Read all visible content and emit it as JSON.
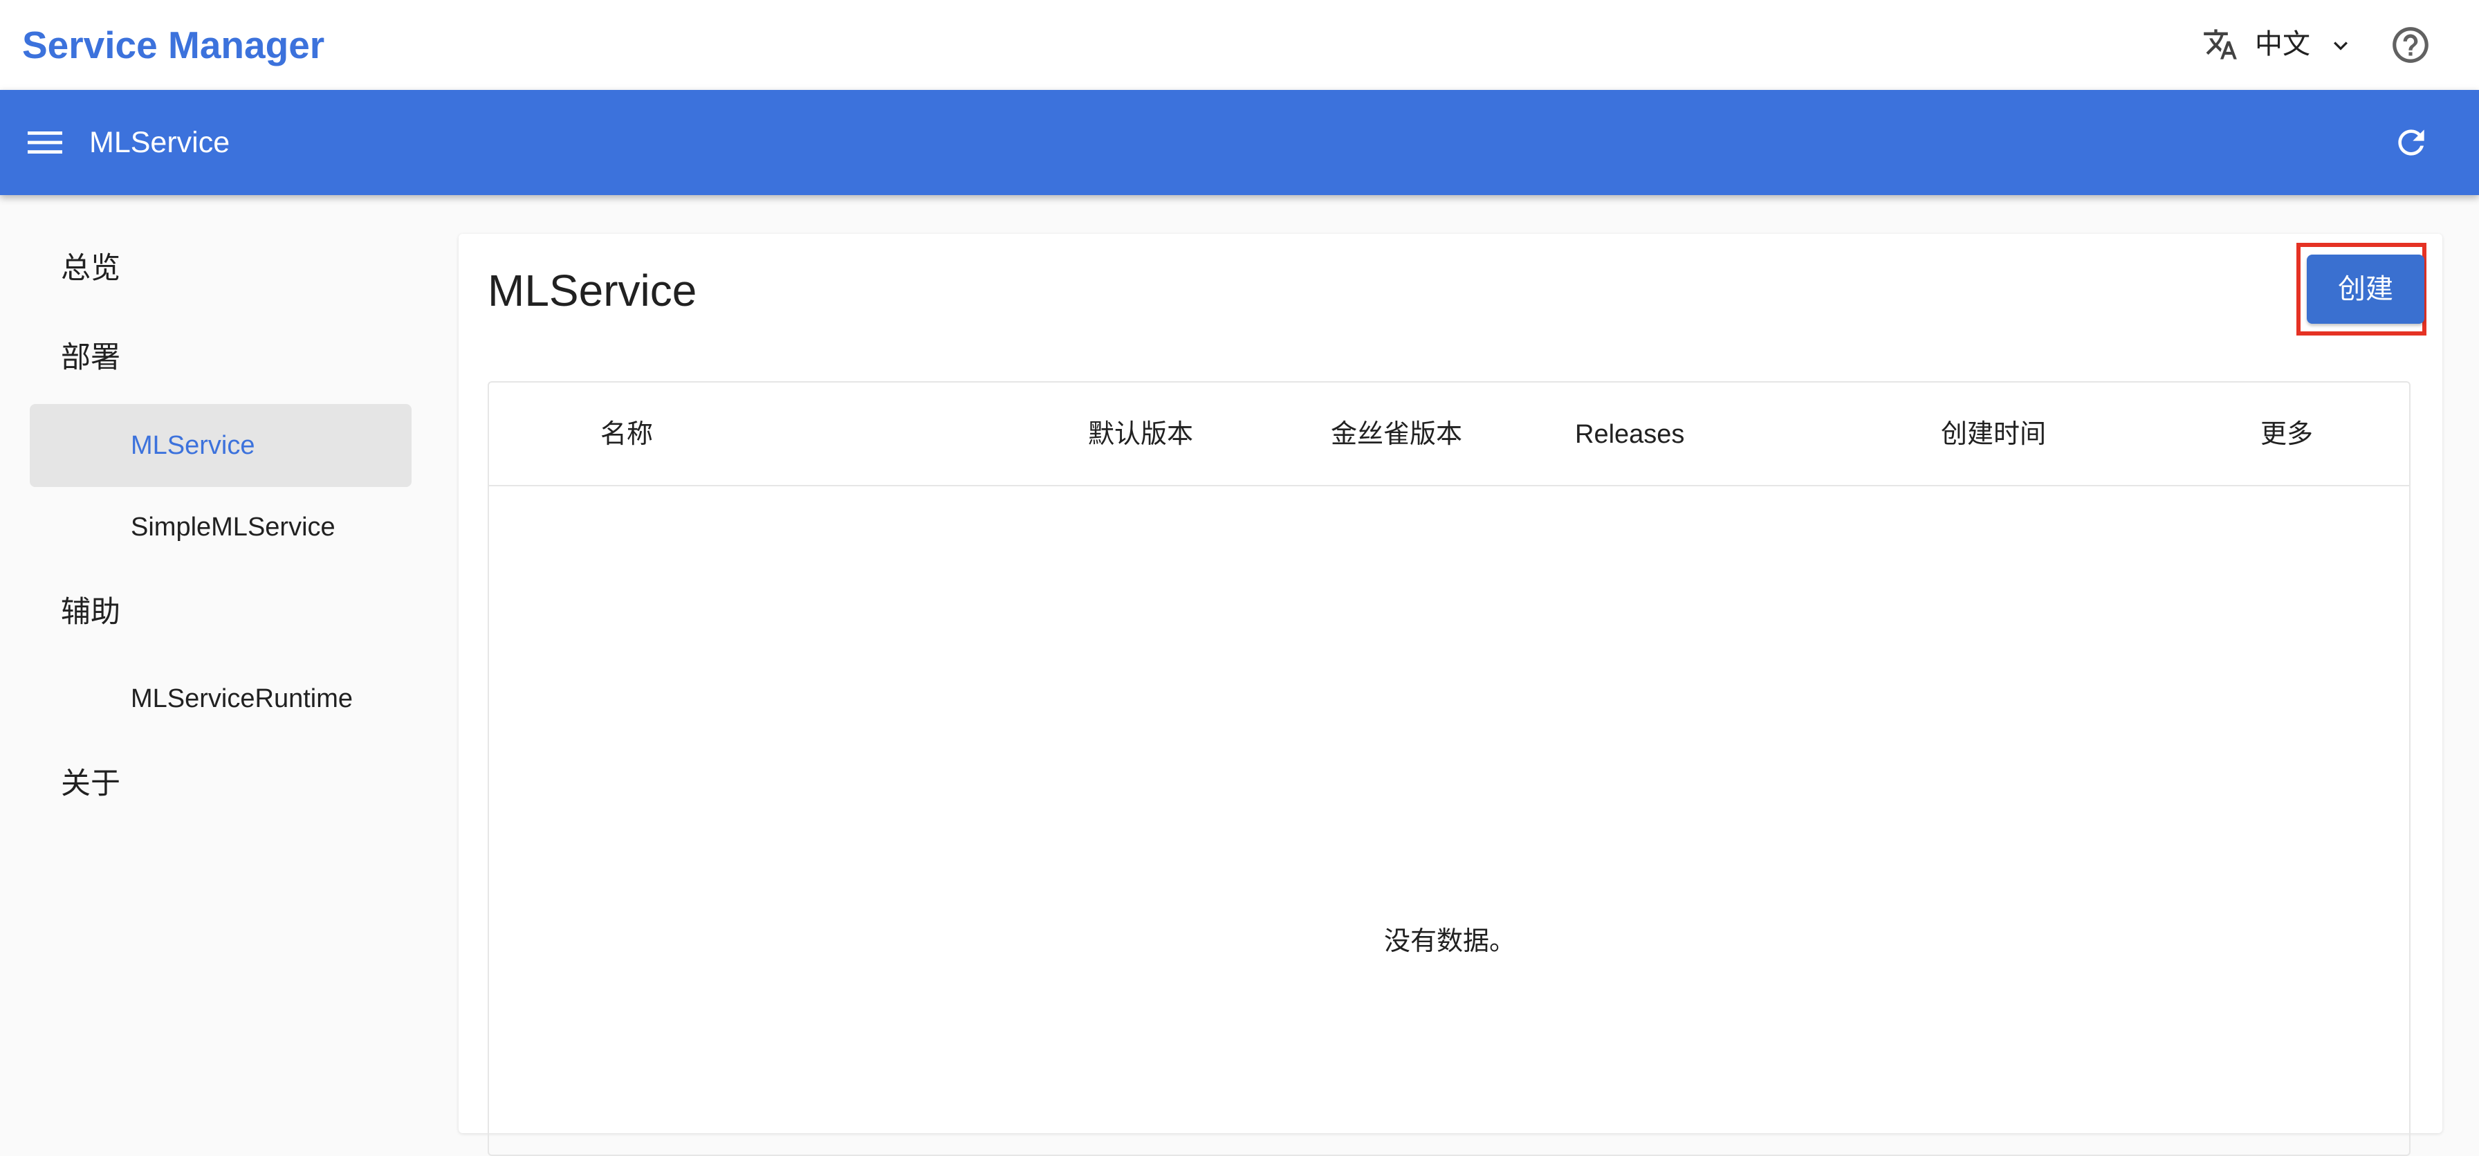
{
  "header": {
    "app_title": "Service Manager",
    "language": "中文",
    "language_icon": "translate-icon",
    "help_icon": "help-circle-icon"
  },
  "toolbar": {
    "title": "MLService",
    "menu_icon": "hamburger-menu-icon",
    "refresh_icon": "refresh-icon"
  },
  "sidebar": {
    "groups": [
      {
        "label": "总览"
      },
      {
        "label": "部署",
        "items": [
          {
            "label": "MLService",
            "active": true
          },
          {
            "label": "SimpleMLService"
          }
        ]
      },
      {
        "label": "辅助",
        "items": [
          {
            "label": "MLServiceRuntime"
          }
        ]
      },
      {
        "label": "关于"
      }
    ]
  },
  "main": {
    "title": "MLService",
    "create_button": "创建",
    "table": {
      "columns": [
        "名称",
        "默认版本",
        "金丝雀版本",
        "Releases",
        "创建时间",
        "更多"
      ],
      "rows": [],
      "empty_text": "没有数据。"
    }
  },
  "colors": {
    "brand": "#3c72dc",
    "button": "#3a70d0",
    "highlight": "#e53224",
    "active_nav_bg": "#e5e5e5"
  }
}
